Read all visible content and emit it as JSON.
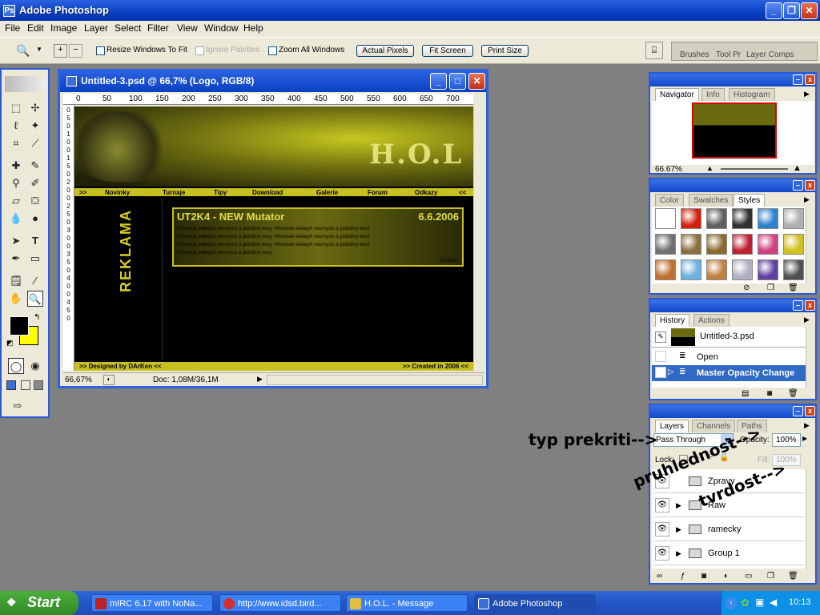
{
  "app": {
    "title": "Adobe Photoshop"
  },
  "menu": [
    "File",
    "Edit",
    "Image",
    "Layer",
    "Select",
    "Filter",
    "View",
    "Window",
    "Help"
  ],
  "options": {
    "resize_windows": "Resize Windows To Fit",
    "ignore_palettes": "Ignore Palettes",
    "zoom_all": "Zoom All Windows",
    "actual_pixels": "Actual Pixels",
    "fit_screen": "Fit Screen",
    "print_size": "Print Size",
    "palette_well": [
      "Brushes",
      "Tool Pr",
      "Layer Comps"
    ]
  },
  "document": {
    "title": "Untitled-3.psd @ 66,7% (Logo, RGB/8)",
    "zoom": "66,67%",
    "doc_info": "Doc: 1,08M/36,1M",
    "ruler_h": [
      "0",
      "50",
      "100",
      "150",
      "200",
      "250",
      "300",
      "350",
      "400",
      "450",
      "500",
      "550",
      "600",
      "650",
      "700"
    ],
    "ruler_v": [
      "0",
      "5",
      "0",
      "1",
      "0",
      "0",
      "1",
      "5",
      "0",
      "2",
      "0",
      "0",
      "2",
      "5",
      "0",
      "3",
      "0",
      "0",
      "3",
      "5",
      "0",
      "4",
      "0",
      "0",
      "4",
      "5",
      "0"
    ]
  },
  "website": {
    "logo": "H.O.L",
    "nav": [
      ">>",
      "Novinky",
      "Turnaje",
      "Tipy",
      "Download",
      "Galerie",
      "Forum",
      "Odkazy",
      "<<"
    ],
    "news_title": "UT2K4 - NEW Mutator",
    "news_date": "6.6.2006",
    "news_lines": [
      "Hromada velkejch nesmyslu a podobny kecy. Hromada velkejch nesmyslu a podobny kecy",
      "Hromada velkejch nesmyslu a podobny kecy. Hromada velkejch nesmyslu a podobny kecy",
      "Hromada velkejch nesmyslu a podobny kecy. Hromada velkejch nesmyslu a podobny kecy",
      "Hromada velkejch nesmyslu a podobny kecy"
    ],
    "news_author": "DArKen",
    "sidebar_text": "REKLAMA",
    "footer_left": ">> Designed by DArKen <<",
    "footer_right": ">> Created in 2006 <<"
  },
  "navigator": {
    "tabs": [
      "Navigator",
      "Info",
      "Histogram"
    ],
    "zoom": "66.67%"
  },
  "styles": {
    "tabs": [
      "Color",
      "Swatches",
      "Styles"
    ],
    "swatches": [
      "#ffffff",
      "#d02010",
      "#606060",
      "#303030",
      "#3080d0",
      "#b0b0b0",
      "#707070",
      "#8a7040",
      "#8a6a30",
      "#c02030",
      "#d04080",
      "#d0c020",
      "#c07030",
      "#70b0e0",
      "#c08040",
      "#b0b0c0",
      "#6040a0",
      "#505050"
    ]
  },
  "history": {
    "tabs": [
      "History",
      "Actions"
    ],
    "snapshot": "Untitled-3.psd",
    "items": [
      "Open",
      "Master Opacity Change"
    ]
  },
  "layers": {
    "tabs": [
      "Layers",
      "Channels",
      "Paths"
    ],
    "blend_mode": "Pass Through",
    "opacity_label": "Opacity:",
    "opacity": "100%",
    "lock_label": "Lock:",
    "fill_label": "Fill:",
    "fill": "100%",
    "items": [
      "Zpravy",
      "Raw",
      "ramecky",
      "Group 1"
    ]
  },
  "annotations": {
    "blend": "typ prekriti-->",
    "opacity": "pruhlednost-->",
    "fill": "tvrdost-->"
  },
  "taskbar": {
    "start": "Start",
    "tasks": [
      "mIRC 6.17 with NoNa...",
      "http://www.idsd.bird...",
      "H.O.L. - Message",
      "Adobe Photoshop"
    ],
    "clock": "10:13"
  },
  "colors": {
    "foreground": "#000000",
    "background": "#ffff00",
    "xp_blue": "#2a62e0"
  }
}
